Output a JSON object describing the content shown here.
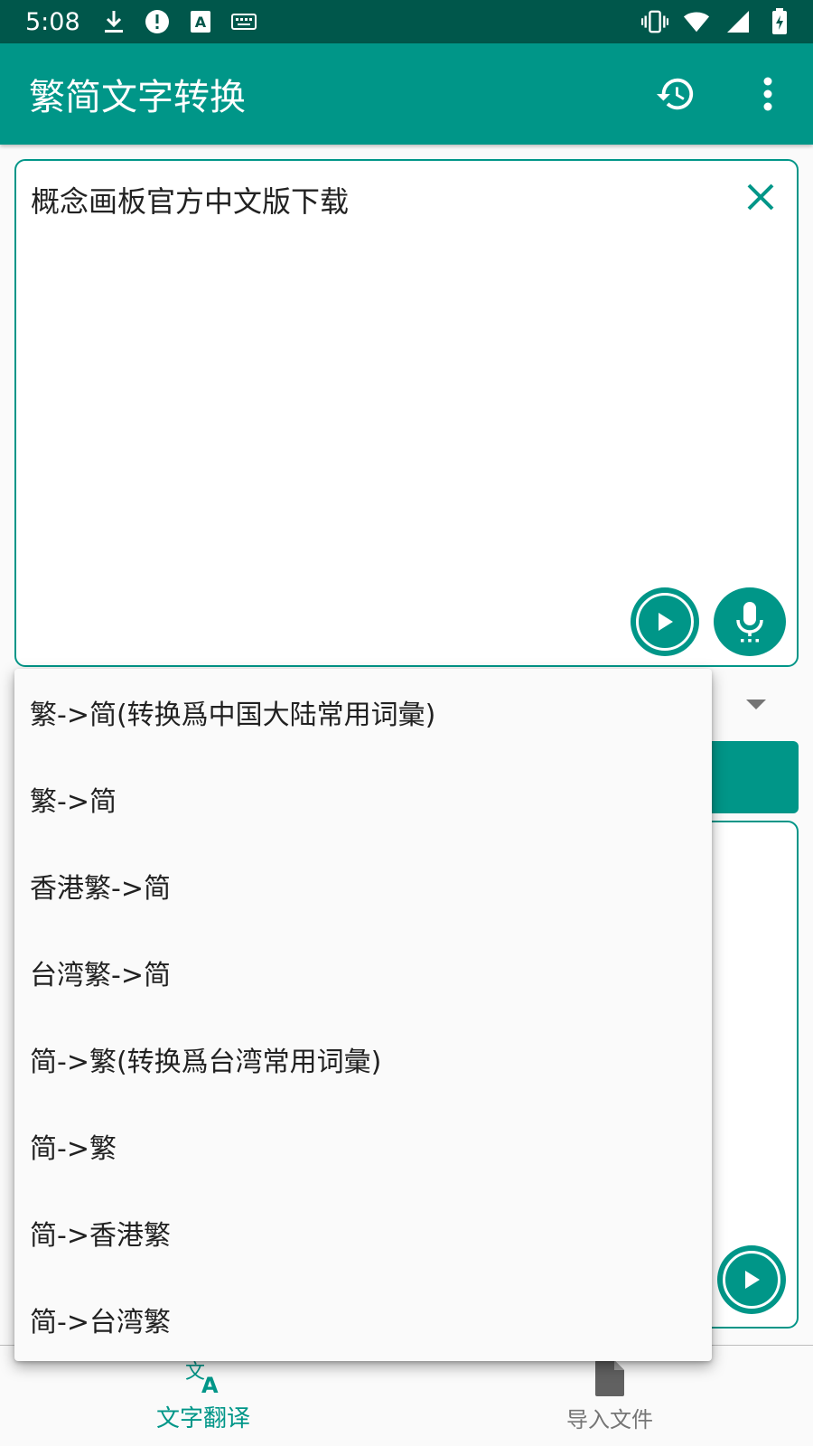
{
  "status_bar": {
    "time": "5:08",
    "left_icons": [
      "download-icon",
      "alert-icon",
      "a-icon",
      "keyboard-icon"
    ],
    "right_icons": [
      "vibrate-icon",
      "wifi-icon",
      "signal-icon",
      "battery-icon"
    ]
  },
  "app_bar": {
    "title": "繁简文字转换",
    "actions": [
      "history-icon",
      "more-vert-icon"
    ]
  },
  "input": {
    "text": "概念画板官方中文版下载"
  },
  "dropdown": {
    "options": [
      "繁->简(转换爲中国大陆常用词彙)",
      "繁->简",
      "香港繁->简",
      "台湾繁->简",
      "简->繁(转换爲台湾常用词彙)",
      "简->繁",
      "简->香港繁",
      "简->台湾繁"
    ]
  },
  "bottom_nav": {
    "items": [
      {
        "label": "文字翻译",
        "icon": "translate-icon",
        "active": true
      },
      {
        "label": "导入文件",
        "icon": "file-icon",
        "active": false
      }
    ]
  },
  "colors": {
    "primary": "#009688",
    "primary_dark": "#00574b",
    "accent": "#009688"
  }
}
